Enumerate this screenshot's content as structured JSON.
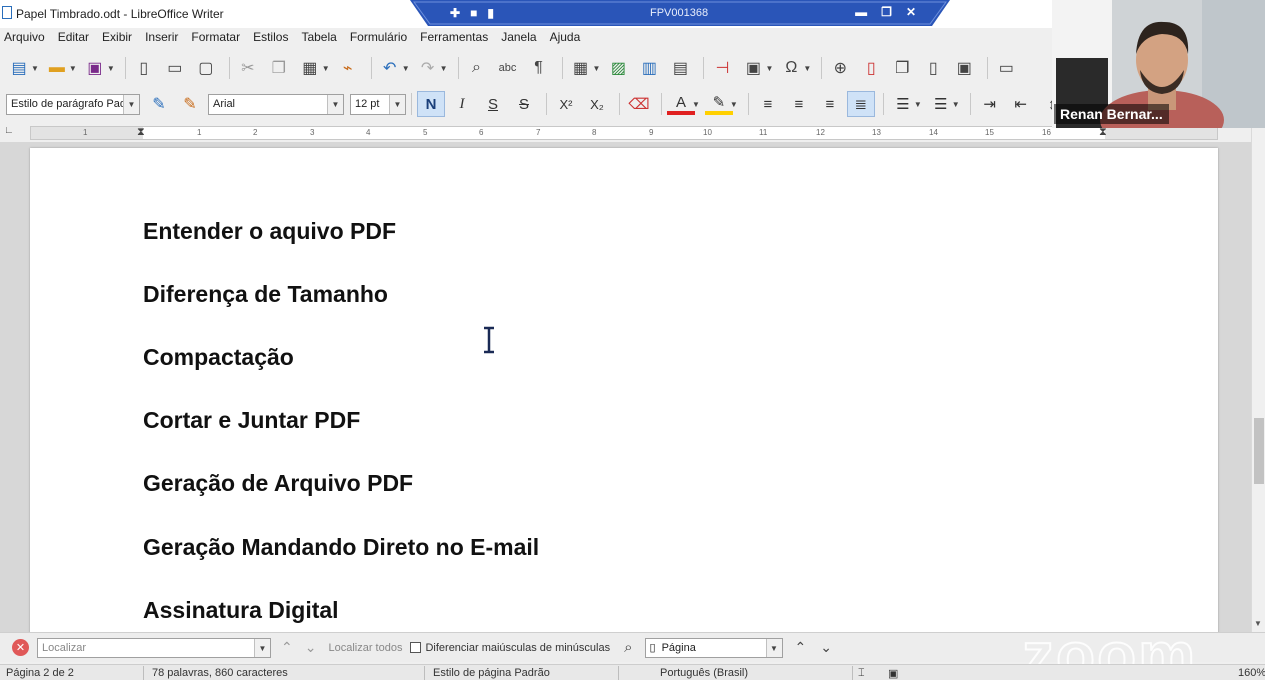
{
  "window": {
    "title": "Papel Timbrado.odt - LibreOffice Writer"
  },
  "share_bar": {
    "meeting_id": "FPV001368",
    "icons": [
      "pin-icon",
      "lock-icon",
      "signal-icon"
    ],
    "window_buttons": [
      "minimize-icon",
      "restore-icon",
      "close-icon"
    ]
  },
  "menu": {
    "items": [
      "Arquivo",
      "Editar",
      "Exibir",
      "Inserir",
      "Formatar",
      "Estilos",
      "Tabela",
      "Formulário",
      "Ferramentas",
      "Janela",
      "Ajuda"
    ]
  },
  "formatting": {
    "paragraph_style": "Estilo de parágrafo Padrão",
    "font_name": "Arial",
    "font_size": "12 pt",
    "bold_label": "N",
    "italic_label": "I",
    "underline_label": "S",
    "strike_label": "S",
    "superscript_label": "X²",
    "subscript_label": "X₂",
    "font_color_label": "A"
  },
  "ruler": {
    "ticks": [
      "1",
      "1",
      "2",
      "3",
      "4",
      "5",
      "6",
      "7",
      "8",
      "9",
      "10",
      "11",
      "12",
      "13",
      "14",
      "15",
      "16"
    ]
  },
  "document": {
    "headings": [
      "Entender o aquivo PDF",
      "Diferença de Tamanho",
      "Compactação",
      "Cortar e Juntar PDF",
      "Geração de Arquivo PDF",
      "Geração Mandando Direto no E-mail",
      "Assinatura Digital"
    ]
  },
  "find_bar": {
    "placeholder": "Localizar",
    "find_all_label": "Localizar todos",
    "match_case_label": "Diferenciar maiúsculas de minúsculas",
    "search_type": "Página"
  },
  "status_bar": {
    "page": "Página 2 de 2",
    "words": "78 palavras, 860 caracteres",
    "page_style": "Estilo de página Padrão",
    "language": "Português (Brasil)",
    "zoom": "160%"
  },
  "webcam": {
    "participant_name": "Renan Bernar..."
  },
  "watermark": {
    "text": "zoom"
  },
  "colors": {
    "share_bar": "#2a55b8",
    "font_color_bar": "#e02020",
    "highlight_bar": "#ffd000",
    "bold_active": "#cfe2f7"
  }
}
